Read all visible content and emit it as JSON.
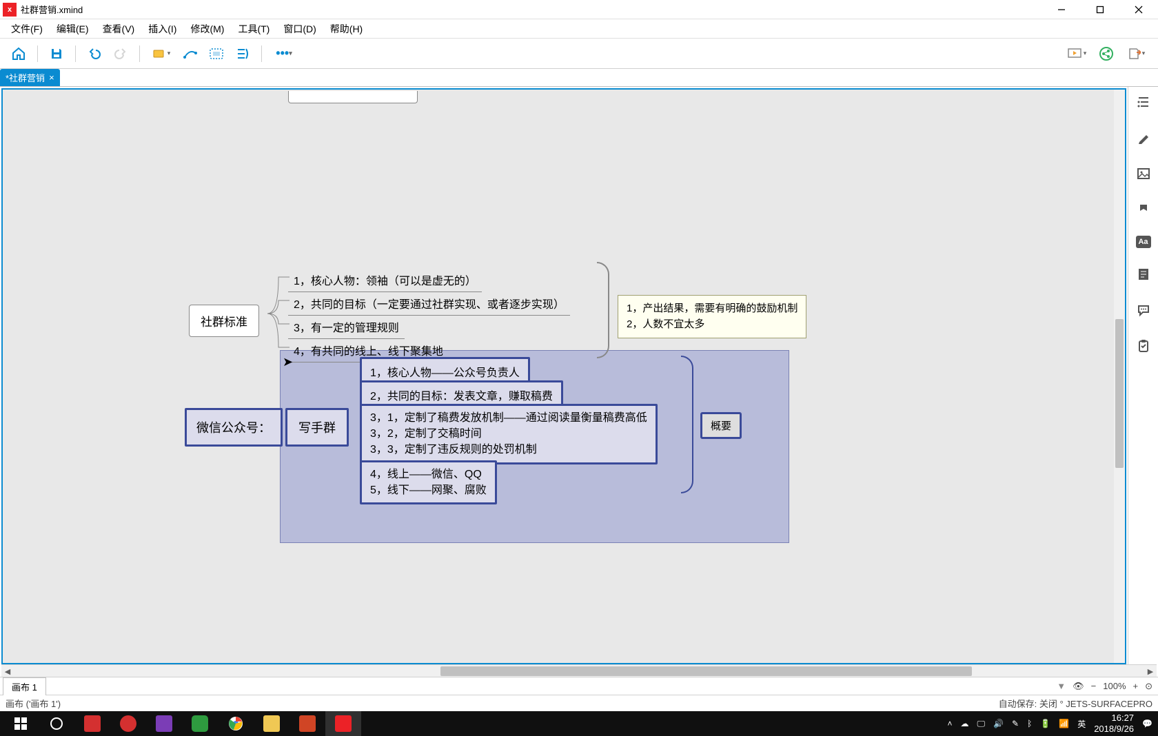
{
  "title": "社群营销.xmind",
  "menu": {
    "file": "文件(F)",
    "edit": "编辑(E)",
    "view": "查看(V)",
    "insert": "插入(I)",
    "modify": "修改(M)",
    "tools": "工具(T)",
    "window": "窗口(D)",
    "help": "帮助(H)"
  },
  "tab": {
    "name": "*社群营销"
  },
  "nodes": {
    "topic1": "社群标准",
    "t1_1": "1，核心人物：领袖（可以是虚无的）",
    "t1_2": "2，共同的目标（一定要通过社群实现、或者逐步实现）",
    "t1_3": "3，有一定的管理规则",
    "t1_4": "4，有共同的线上、线下聚集地",
    "note1_l1": "1，产出结果，需要有明确的鼓励机制",
    "note1_l2": "2，人数不宜太多",
    "topic2a": "微信公众号：",
    "topic2b": "写手群",
    "t2_1": "1，核心人物——公众号负责人",
    "t2_2": "2，共同的目标：发表文章，赚取稿费",
    "t2_3a": "3，1，定制了稿费发放机制——通过阅读量衡量稿费高低",
    "t2_3b": "3，2，定制了交稿时间",
    "t2_3c": "3，3，定制了违反规则的处罚机制",
    "t2_4a": "4，线上——微信、QQ",
    "t2_4b": "5，线下——网聚、腐败",
    "summary": "概要"
  },
  "sheet": "画布 1",
  "status_left": "画布 ('画布 1')",
  "status_right": "自动保存: 关闭  °  JETS-SURFACEPRO",
  "zoom": {
    "percent": "100%",
    "minus": "−",
    "plus": "+",
    "reset": "⊙"
  },
  "taskbar": {
    "ime": "英",
    "time": "16:27",
    "date": "2018/9/26"
  }
}
